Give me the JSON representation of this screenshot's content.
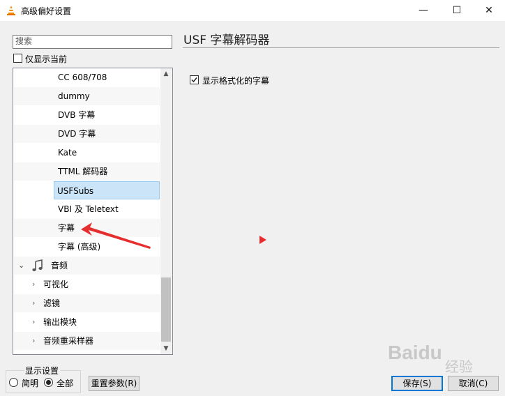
{
  "window": {
    "title": "高级偏好设置",
    "minimize": "—",
    "maximize": "☐",
    "close": "✕"
  },
  "search": {
    "placeholder": "搜索"
  },
  "show_current_label": "仅显示当前",
  "tree": {
    "items": [
      {
        "label": "CC 608/708",
        "level": 2
      },
      {
        "label": "dummy",
        "level": 2
      },
      {
        "label": "DVB 字幕",
        "level": 2
      },
      {
        "label": "DVD 字幕",
        "level": 2
      },
      {
        "label": "Kate",
        "level": 2
      },
      {
        "label": "TTML 解码器",
        "level": 2
      },
      {
        "label": "USFSubs",
        "level": 2,
        "selected": true
      },
      {
        "label": "VBI 及 Teletext",
        "level": 2
      },
      {
        "label": "字幕",
        "level": 2
      },
      {
        "label": "字幕 (高级)",
        "level": 2
      },
      {
        "label": "音频",
        "level": 0,
        "expanded": true,
        "icon": "music-note-icon"
      },
      {
        "label": "可视化",
        "level": 1
      },
      {
        "label": "滤镜",
        "level": 1
      },
      {
        "label": "输出模块",
        "level": 1
      },
      {
        "label": "音频重采样器",
        "level": 1
      }
    ]
  },
  "panel": {
    "title": "USF  字幕解码器",
    "option_label": "显示格式化的字幕"
  },
  "display": {
    "group_title": "显示设置",
    "simple": "简明",
    "all": "全部"
  },
  "buttons": {
    "reset": "重置参数(R)",
    "save": "保存(S)",
    "cancel": "取消(C)"
  },
  "watermark": {
    "text": "Baidu",
    "suffix": "经验"
  },
  "colors": {
    "accent": "#0078d7",
    "selected_row": "#cce4f7",
    "annotation_arrow": "#e62e2e"
  }
}
